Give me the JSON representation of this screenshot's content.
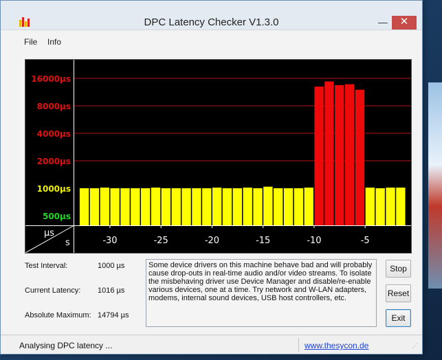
{
  "window": {
    "title": "DPC Latency Checker V1.3.0",
    "minimize_glyph": "—",
    "close_glyph": "✕"
  },
  "menu": [
    "File",
    "Info"
  ],
  "chart_data": {
    "type": "bar",
    "y_scale": "log",
    "y_unit": "µs",
    "x_unit": "s",
    "y_ticks": [
      {
        "label": "16000µs",
        "value": 16000,
        "color": "#e01010"
      },
      {
        "label": "8000µs",
        "value": 8000,
        "color": "#e01010"
      },
      {
        "label": "4000µs",
        "value": 4000,
        "color": "#e01010"
      },
      {
        "label": "2000µs",
        "value": 2000,
        "color": "#e01010"
      },
      {
        "label": "1000µs",
        "value": 1000,
        "color": "#f0f000"
      },
      {
        "label": "500µs",
        "value": 500,
        "color": "#22d622"
      }
    ],
    "x_ticks": [
      "-30",
      "-25",
      "-20",
      "-15",
      "-10",
      "-5"
    ],
    "x_tick_values": [
      -30,
      -25,
      -20,
      -15,
      -10,
      -5
    ],
    "x_range": [
      -33,
      0
    ],
    "corner_labels": {
      "top": "µs",
      "bottom": "s"
    },
    "x": [
      -32,
      -31,
      -30,
      -29,
      -28,
      -27,
      -26,
      -25,
      -24,
      -23,
      -22,
      -21,
      -20,
      -19,
      -18,
      -17,
      -16,
      -15,
      -14,
      -13,
      -12,
      -11,
      -10,
      -9,
      -8,
      -7,
      -6,
      -5,
      -4,
      -3,
      -2,
      -1
    ],
    "values": [
      1000,
      1000,
      1016,
      1000,
      1000,
      1000,
      1000,
      1016,
      1000,
      1000,
      1000,
      1000,
      1000,
      1016,
      1000,
      1000,
      1016,
      1000,
      1040,
      1000,
      1000,
      1000,
      1016,
      13000,
      14794,
      13500,
      13800,
      12000,
      1016,
      1000,
      1016,
      1016
    ],
    "colors": {
      "normal": "#ffff00",
      "high": "#ee0a0a",
      "grid": "#b41414",
      "background": "#000000"
    },
    "high_threshold": 2000
  },
  "stats": [
    {
      "label": "Test Interval:",
      "value": "1000 µs"
    },
    {
      "label": "Current Latency:",
      "value": "1016 µs"
    },
    {
      "label": "Absolute Maximum:",
      "value": "14794 µs"
    }
  ],
  "description": "Some device drivers on this machine behave bad and will probably cause drop-outs in real-time audio and/or video streams. To isolate the misbehaving driver use Device Manager and disable/re-enable various devices, one at a time. Try network and W-LAN adapters, modems, internal sound devices, USB host controllers, etc.",
  "buttons": {
    "stop": "Stop",
    "reset": "Reset",
    "exit": "Exit"
  },
  "status": {
    "text": "Analysing DPC latency ...",
    "link": "www.thesycon.de"
  }
}
